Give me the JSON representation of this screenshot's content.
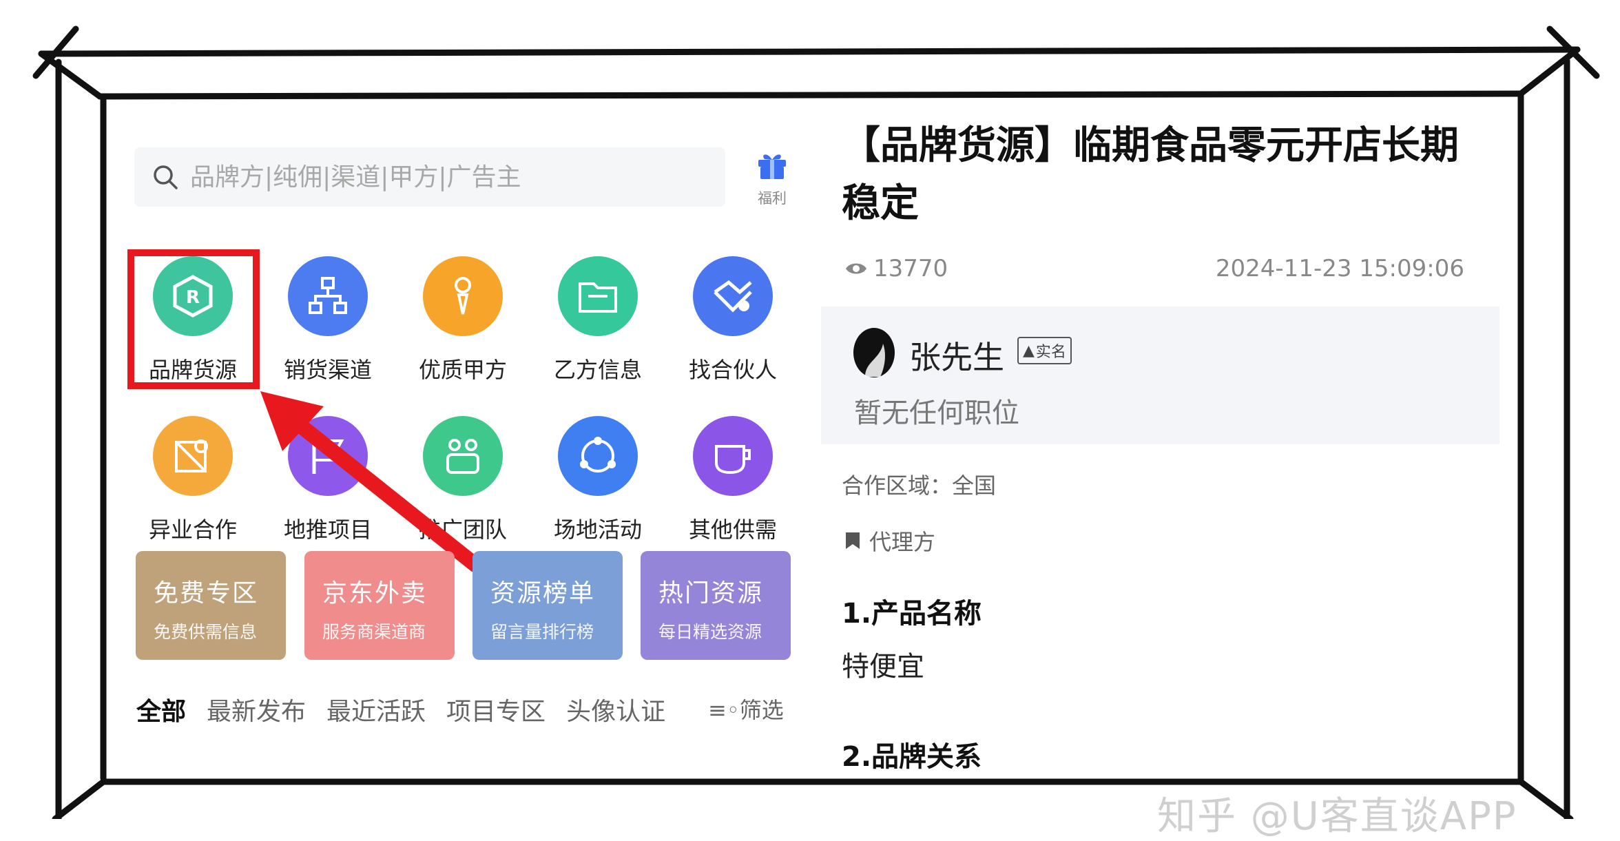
{
  "search": {
    "placeholder": "品牌方|纯佣|渠道|甲方|广告主"
  },
  "gift": {
    "label": "福利"
  },
  "categories": [
    {
      "label": "品牌货源",
      "color": "#3ec59e",
      "icon": "brand-r-icon"
    },
    {
      "label": "销货渠道",
      "color": "#4c7cf0",
      "icon": "org-chart-icon"
    },
    {
      "label": "优质甲方",
      "color": "#f6a52a",
      "icon": "tie-person-icon"
    },
    {
      "label": "乙方信息",
      "color": "#35c89a",
      "icon": "folder-icon"
    },
    {
      "label": "找合伙人",
      "color": "#4a76f0",
      "icon": "handshake-icon"
    },
    {
      "label": "异业合作",
      "color": "#f4a93a",
      "icon": "cross-link-icon"
    },
    {
      "label": "地推项目",
      "color": "#8e58ea",
      "icon": "flag-icon"
    },
    {
      "label": "推广团队",
      "color": "#3fc88b",
      "icon": "team-icon"
    },
    {
      "label": "场地活动",
      "color": "#3f7ff2",
      "icon": "share-circle-icon"
    },
    {
      "label": "其他供需",
      "color": "#8b55e8",
      "icon": "cup-icon"
    }
  ],
  "banners": [
    {
      "title": "免费专区",
      "sub": "免费供需信息",
      "color": "#bfa27a"
    },
    {
      "title": "京东外卖",
      "sub": "服务商渠道商",
      "color": "#f08c8c"
    },
    {
      "title": "资源榜单",
      "sub": "留言量排行榜",
      "color": "#7b9fd6"
    },
    {
      "title": "热门资源",
      "sub": "每日精选资源",
      "color": "#9585d8"
    }
  ],
  "tabs": [
    "全部",
    "最新发布",
    "最近活跃",
    "项目专区",
    "头像认证"
  ],
  "filter_label": "筛选",
  "post": {
    "title": "【品牌货源】临期食品零元开店长期稳定",
    "views": "13770",
    "date": "2024-11-23 15:09:06",
    "user_name": "张先生",
    "verified_badge": "实名",
    "position": "暂无任何职位",
    "region": "合作区域：全国",
    "role": "代理方",
    "section1_title": "1.产品名称",
    "section1_value": "特便宜",
    "section2_title": "2.品牌关系"
  },
  "watermark": "知乎 @U客直谈APP",
  "colors": {
    "highlight": "#e8191e",
    "arrow": "#e8191e"
  }
}
